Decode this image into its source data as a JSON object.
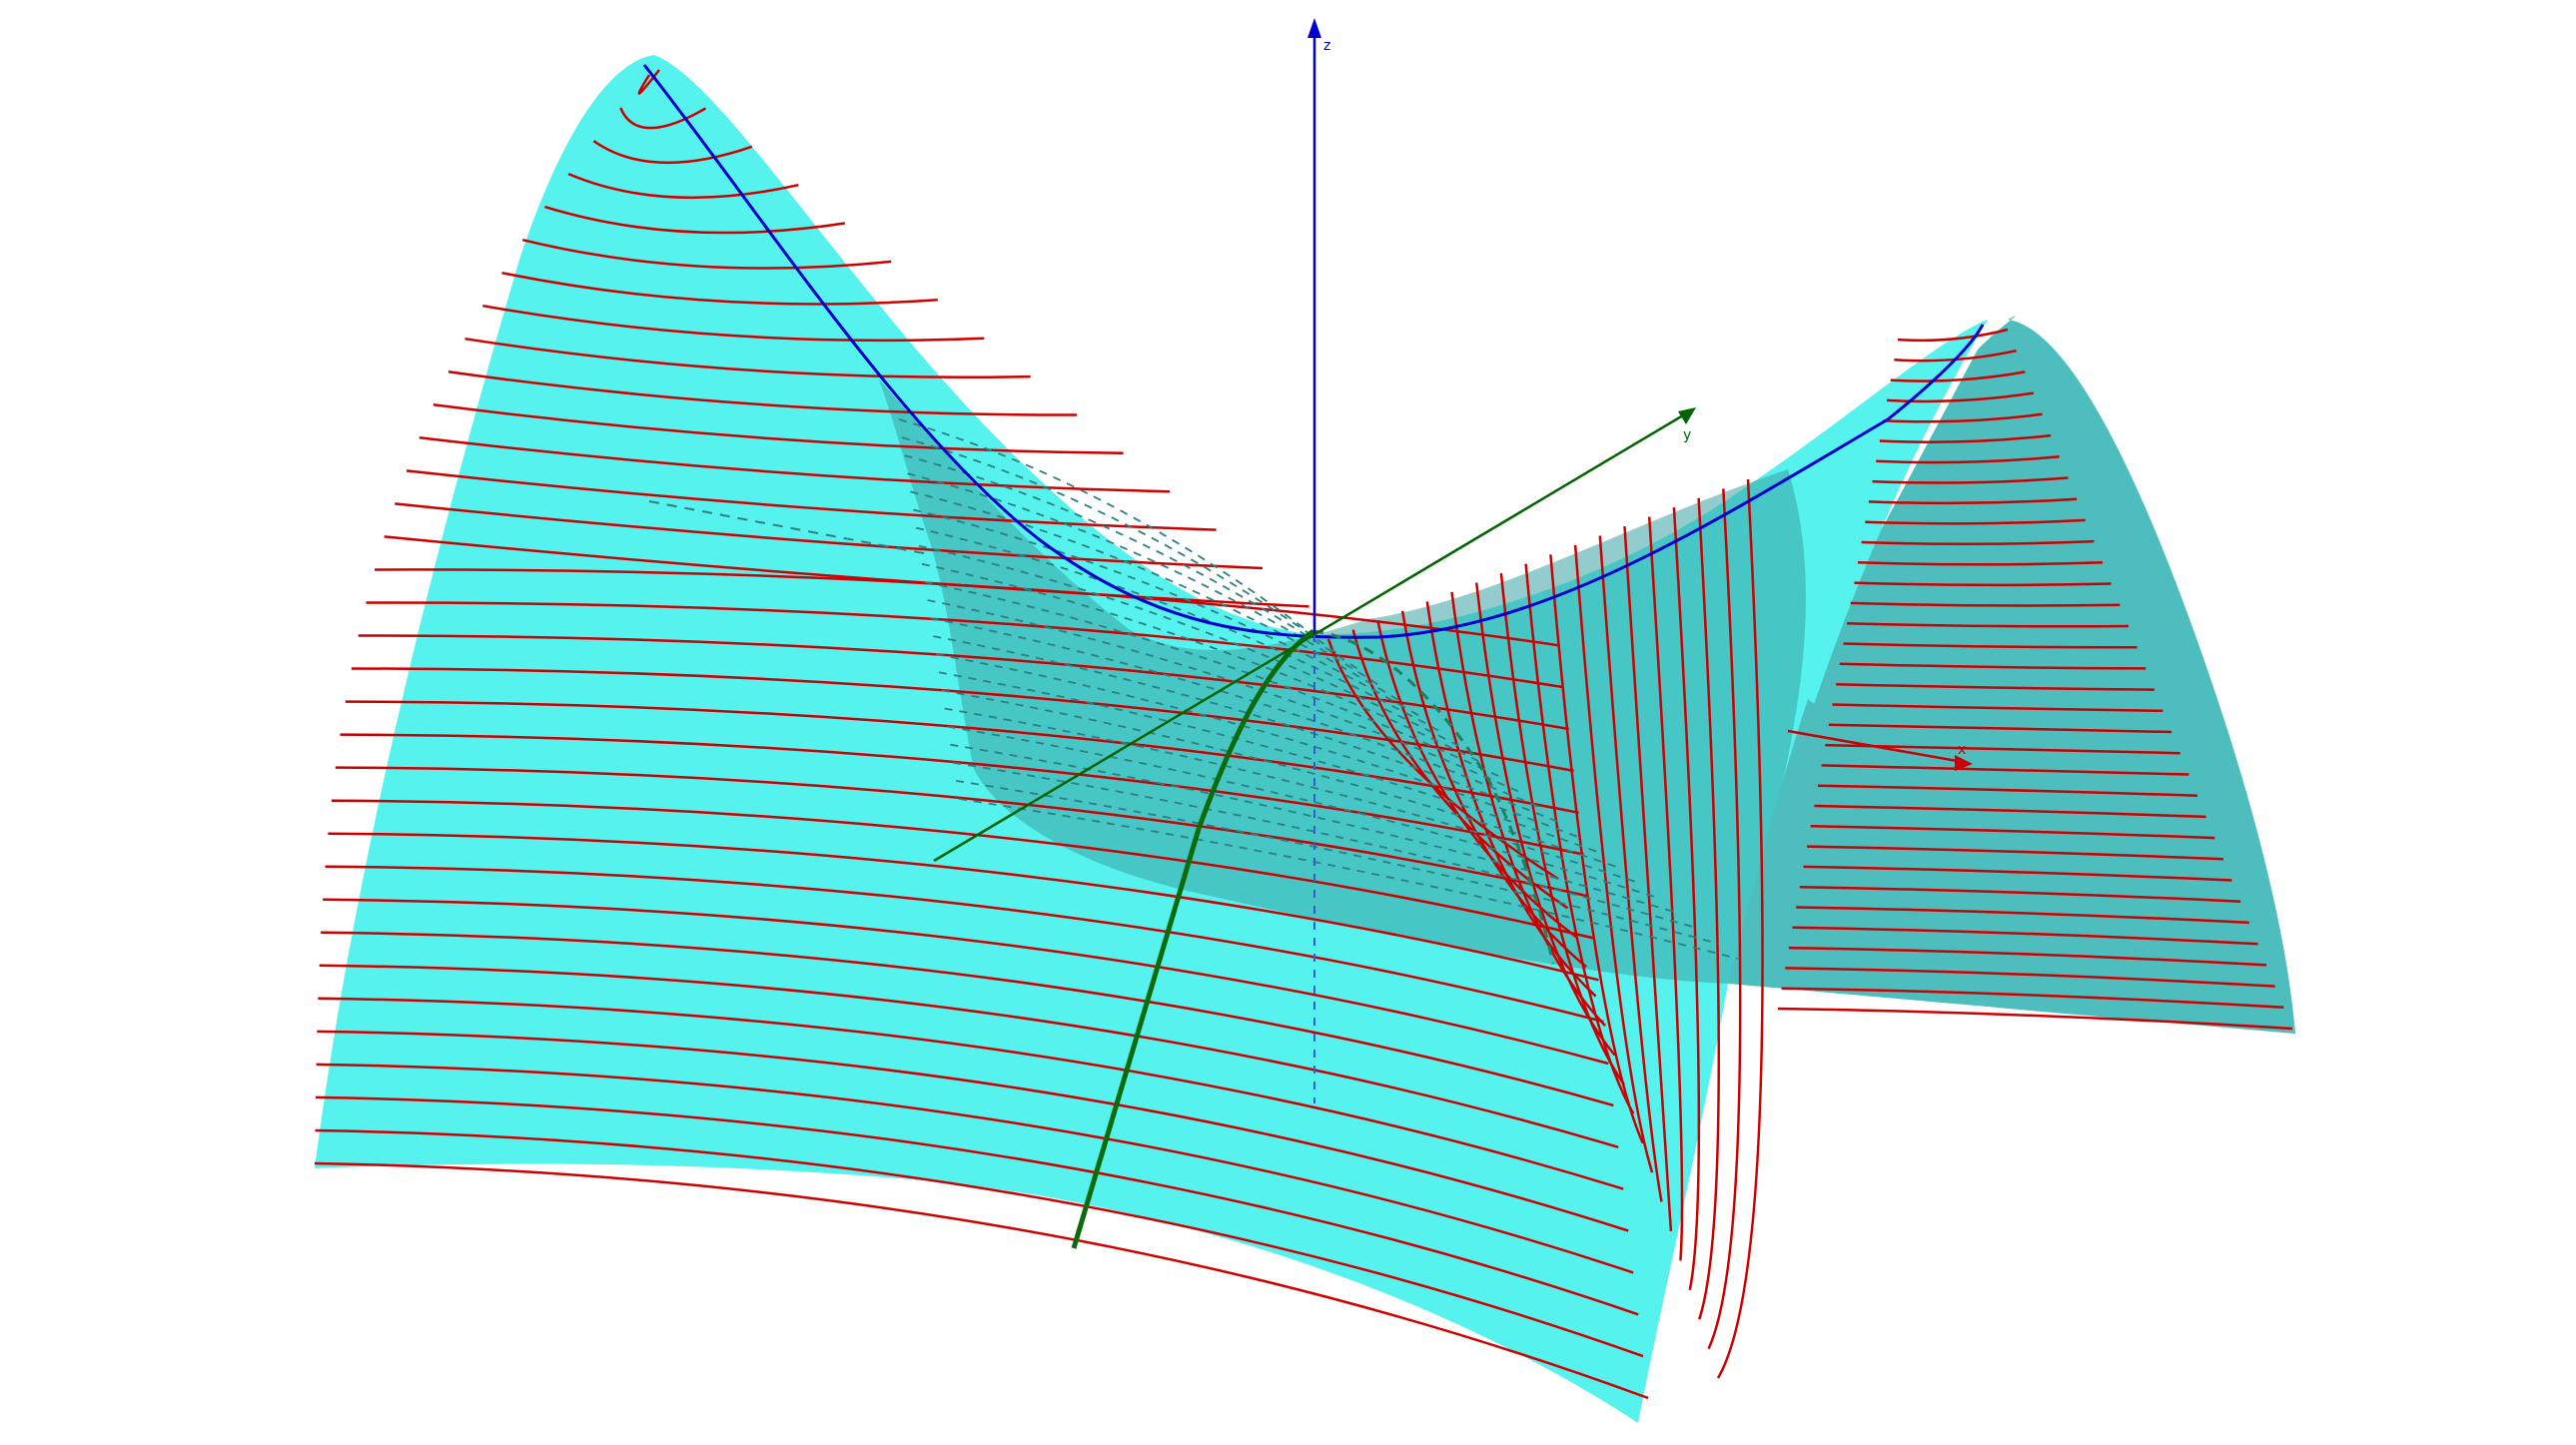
{
  "view": {
    "background": "#ffffff"
  },
  "axes": {
    "x": {
      "label": "x",
      "color": "#cc0000"
    },
    "y": {
      "label": "y",
      "color": "#006400"
    },
    "z": {
      "label": "z",
      "color": "#0000cc"
    }
  },
  "surface": {
    "kind": "hyperbolic-paraboloid",
    "fill_front": "#55f2ee",
    "fill_back": "#4dbdbd",
    "fill_shadow": "#3aa3a3",
    "edge_color": "#2f8f8f"
  },
  "curves": {
    "level_curves_color": "#cc0000",
    "level_curves_count": 34,
    "parabola_blue_color": "#0000cc",
    "parabola_green_color": "#0a6b0a",
    "hidden_line_color": "#2f7f7f"
  }
}
